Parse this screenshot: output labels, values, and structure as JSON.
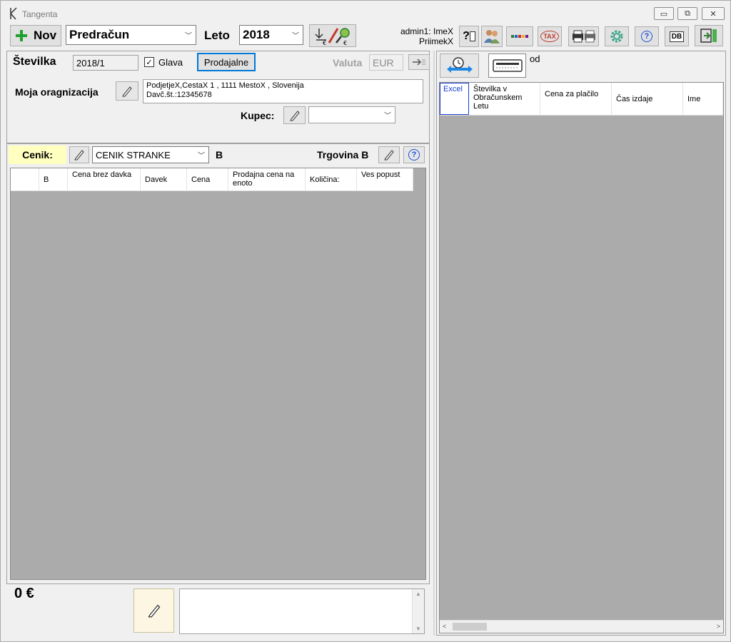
{
  "window": {
    "title": "Tangenta",
    "minimize_glyph": "▭",
    "restore_glyph": "⧉",
    "close_glyph": "✕"
  },
  "toolbar": {
    "new_label": "Nov",
    "doc_type_value": "Predračun",
    "year_label": "Leto",
    "year_value": "2018",
    "user_line1": "admin1: ImeX",
    "user_line2": "PriimekX",
    "help_q_label": "?",
    "tax_label": "TAX",
    "help_label": "?",
    "db_label": "DB"
  },
  "header": {
    "number_label": "Številka",
    "number_value": "2018/1",
    "head_checkbox_label": "Glava",
    "head_checkbox_checked": true,
    "shops_button_label": "Prodajalne",
    "currency_label": "Valuta",
    "currency_value": "EUR",
    "org_label": "Moja oragnizacija",
    "org_line1": "PodjetjeX,CestaX 1 , 1111 MestoX , Slovenija",
    "org_line2": "Davč.št.:12345678",
    "buyer_label": "Kupec:",
    "buyer_value": ""
  },
  "pricelist": {
    "label": "Cenik:",
    "value": "CENIK STRANKE",
    "suffix": "B",
    "shop_label": "Trgovina B",
    "help_label": "?"
  },
  "items_grid": {
    "columns": [
      "",
      "B",
      "Cena brez davka",
      "Davek",
      "Cena",
      "Prodajna cena na enoto",
      "Količina:",
      "Ves popust"
    ]
  },
  "footer": {
    "total": "0 €",
    "notes_value": ""
  },
  "right_panel": {
    "od_label": "od",
    "columns": [
      "Excel",
      "Številka v Obračunskem Letu",
      "Cena za plačilo",
      "Čas izdaje",
      "Ime"
    ]
  },
  "colors": {
    "pricelist_label_bg": "#ffffc0",
    "grid_bg": "#ababab",
    "focus_border": "#0078d7",
    "green_plus": "#1fa12f"
  }
}
